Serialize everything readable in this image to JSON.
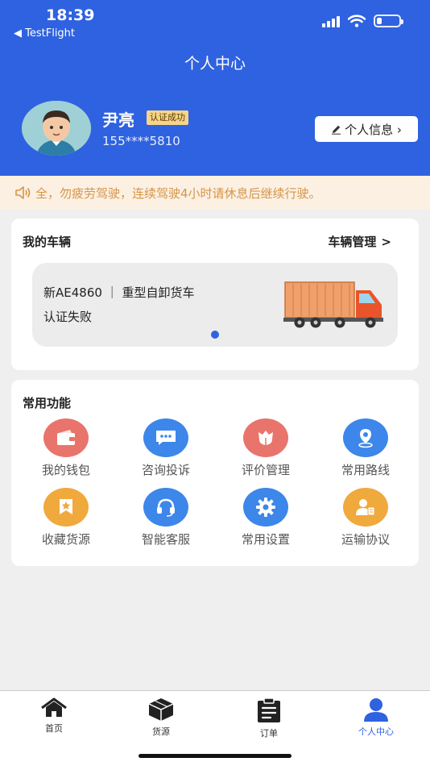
{
  "status_bar": {
    "time": "18:39",
    "back_app": "◀ TestFlight",
    "battery_level": 0.22
  },
  "page_title": "个人中心",
  "user": {
    "name": "尹亮",
    "badge": "认证成功",
    "phone": "155****5810",
    "profile_button": "个人信息 ›"
  },
  "notice": {
    "text": "全，勿疲劳驾驶，连续驾驶4小时请休息后继续行驶。"
  },
  "vehicles": {
    "title": "我的车辆",
    "manage_link": "车辆管理",
    "manage_chevron": ">",
    "items": [
      {
        "plate": "新AE4860 ｜ 重型自卸货车",
        "status": "认证失败"
      }
    ]
  },
  "functions": {
    "title": "常用功能",
    "items": [
      {
        "label": "我的钱包",
        "icon": "wallet-icon",
        "color": "#e8746c"
      },
      {
        "label": "咨询投诉",
        "icon": "chat-icon",
        "color": "#3d86ea"
      },
      {
        "label": "评价管理",
        "icon": "flower-icon",
        "color": "#e8746c"
      },
      {
        "label": "常用路线",
        "icon": "location-pin-icon",
        "color": "#3d86ea"
      },
      {
        "label": "收藏货源",
        "icon": "star-bookmark-icon",
        "color": "#f0a93c"
      },
      {
        "label": "智能客服",
        "icon": "headset-icon",
        "color": "#3d86ea"
      },
      {
        "label": "常用设置",
        "icon": "gear-icon",
        "color": "#3d86ea"
      },
      {
        "label": "运输协议",
        "icon": "user-document-icon",
        "color": "#f0a93c"
      }
    ]
  },
  "tabbar": {
    "active_color": "#2f62e0",
    "items": [
      {
        "label": "首页",
        "icon": "home-icon"
      },
      {
        "label": "货源",
        "icon": "box-icon"
      },
      {
        "label": "订单",
        "icon": "clipboard-icon"
      },
      {
        "label": "个人中心",
        "icon": "person-icon"
      }
    ]
  }
}
